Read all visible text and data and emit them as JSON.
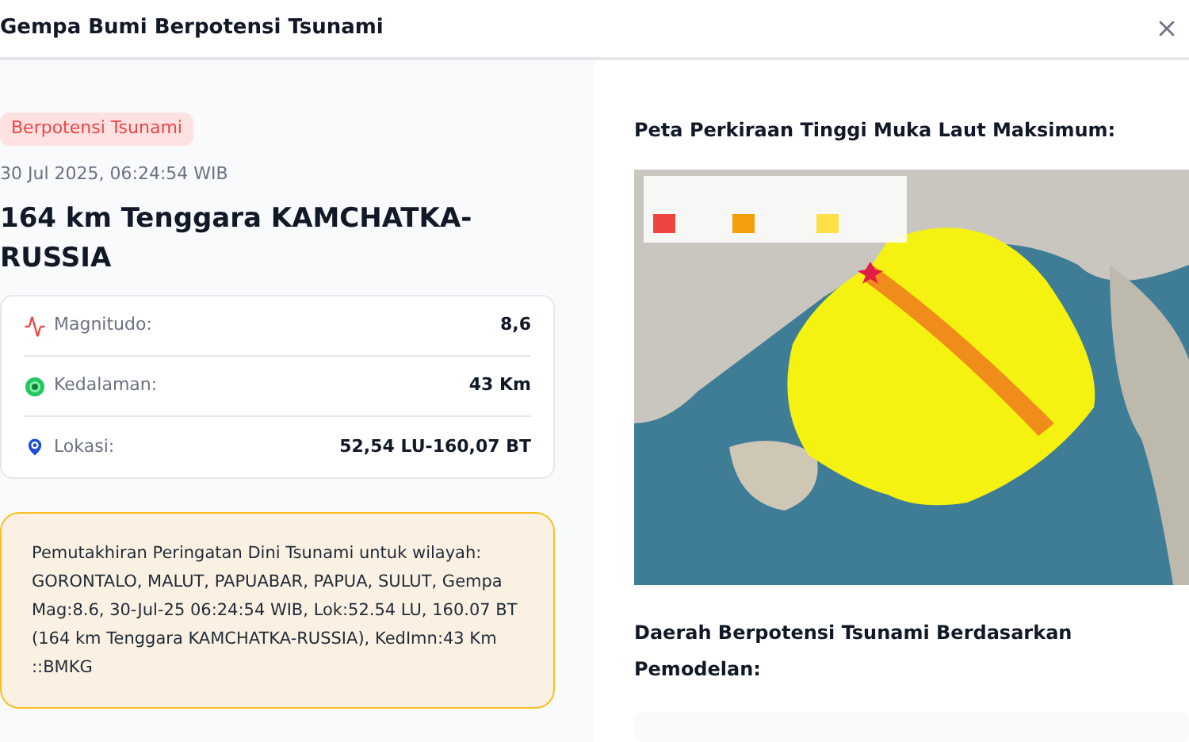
{
  "dialog": {
    "title": "Gempa Bumi Berpotensi Tsunami"
  },
  "event": {
    "badge": "Berpotensi Tsunami",
    "time": "30 Jul 2025, 06:24:54 WIB",
    "location": "164 km Tenggara KAMCHATKA-RUSSIA"
  },
  "details": [
    {
      "kind": "magnitude",
      "label": "Magnitudo:",
      "value": "8,6"
    },
    {
      "kind": "depth",
      "label": "Kedalaman:",
      "value": "43 Km"
    },
    {
      "kind": "location",
      "label": "Lokasi:",
      "value": "52,54 LU-160,07 BT"
    }
  ],
  "warning": "Pemutakhiran Peringatan Dini Tsunami untuk wilayah: GORONTALO, MALUT, PAPUABAR, PAPUA, SULUT, Gempa Mag:8.6, 30-Jul-25 06:24:54 WIB, Lok:52.54 LU, 160.07 BT (164 km Tenggara KAMCHATKA-RUSSIA), KedImn:43 Km ::BMKG",
  "map_section": {
    "heading": "Peta Perkiraan Tinggi Muka Laut Maksimum:"
  },
  "regions_section": {
    "heading": "Daerah Berpotensi Tsunami Berdasarkan Pemodelan:"
  }
}
